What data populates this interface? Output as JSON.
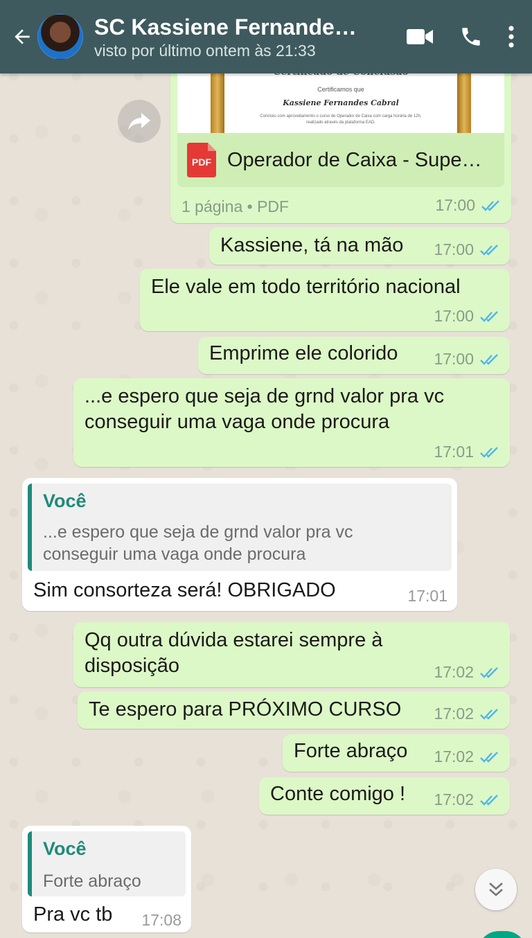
{
  "header": {
    "contact_name": "SC Kassiene Fernandes…",
    "status": "visto por último ontem às 21:33",
    "icons": {
      "back": "arrow-left-icon",
      "video": "video-camera-icon",
      "call": "phone-icon",
      "menu": "more-vert-icon"
    }
  },
  "colors": {
    "header": "#3e5a5e",
    "outgoing": "#dcf8c6",
    "incoming": "#ffffff",
    "read_ticks": "#4fb6ec",
    "quote_accent": "#1f8a7a"
  },
  "document": {
    "preview_title": "Certificado de Conclusão",
    "preview_line": "Certificamos que",
    "preview_name": "Kassiene Fernandes Cabral",
    "preview_body": "Concluiu com aproveitamento o curso de Operador de Caixa com carga horária de 12h, realizado através da plataforma EAD.",
    "file_name": "Operador de Caixa - Supe…",
    "file_info": "1 página • PDF",
    "file_type_label": "PDF",
    "time": "17:00"
  },
  "messages": [
    {
      "text": "Kassiene, tá na mão",
      "time": "17:00"
    },
    {
      "text": "Ele vale em todo território nacional",
      "time": "17:00"
    },
    {
      "text": "Emprime ele colorido",
      "time": "17:00"
    },
    {
      "text": "...e espero que seja de grnd valor pra vc conseguir uma vaga onde procura",
      "time": "17:01"
    },
    {
      "quote_author": "Você",
      "quote_text": "...e espero que seja de grnd valor pra vc conseguir uma vaga onde procura",
      "text": "Sim consorteza será! OBRIGADO",
      "time": "17:01"
    },
    {
      "text": "Qq outra dúvida estarei sempre à disposição",
      "time": "17:02"
    },
    {
      "text": "Te espero para PRÓXIMO CURSO",
      "time": "17:02"
    },
    {
      "text": "Forte abraço",
      "time": "17:02"
    },
    {
      "text": "Conte comigo !",
      "time": "17:02"
    },
    {
      "quote_author": "Você",
      "quote_text": "Forte abraço",
      "text": "Pra vc tb",
      "time": "17:08"
    }
  ]
}
